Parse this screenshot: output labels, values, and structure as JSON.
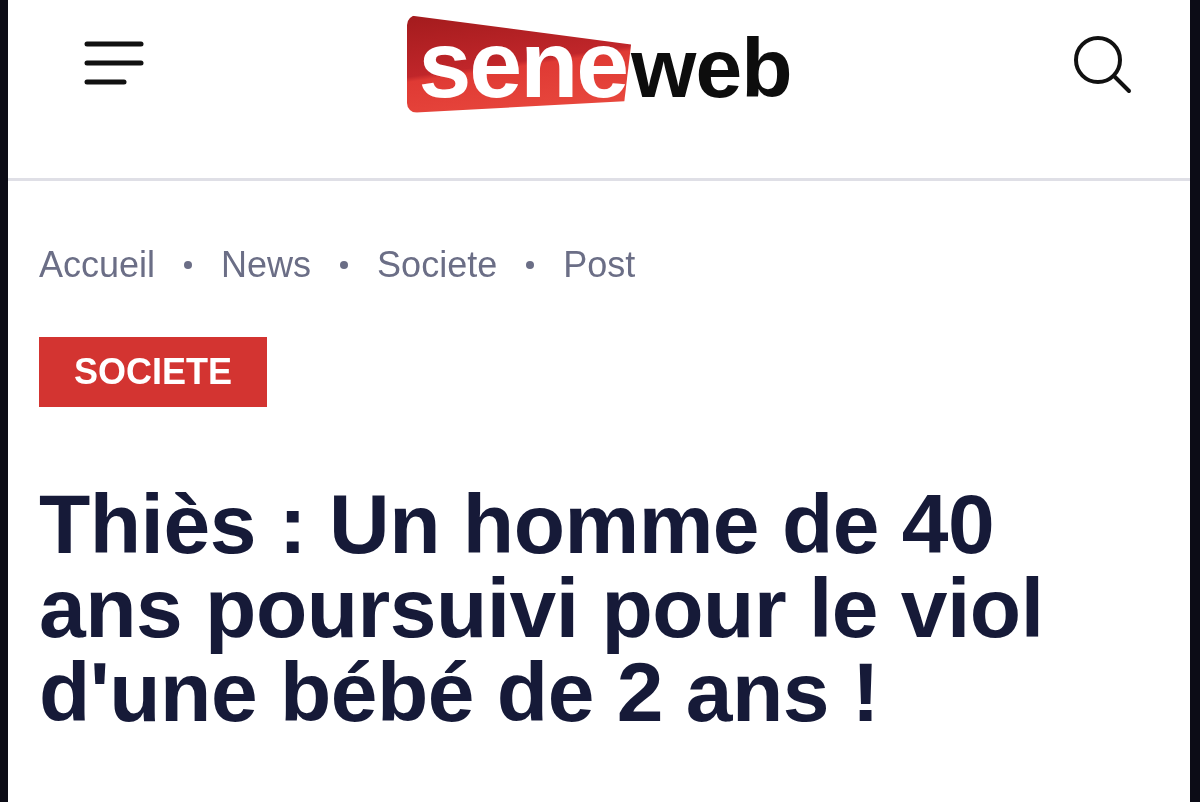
{
  "header": {
    "logo": {
      "highlight": "sene",
      "rest": "web"
    }
  },
  "breadcrumb": [
    {
      "label": "Accueil"
    },
    {
      "label": "News"
    },
    {
      "label": "Societe"
    },
    {
      "label": "Post"
    }
  ],
  "category_badge": "SOCIETE",
  "headline": "Thiès : Un homme de 40 ans poursuivi pour le viol d'une bébé de 2 ans !"
}
